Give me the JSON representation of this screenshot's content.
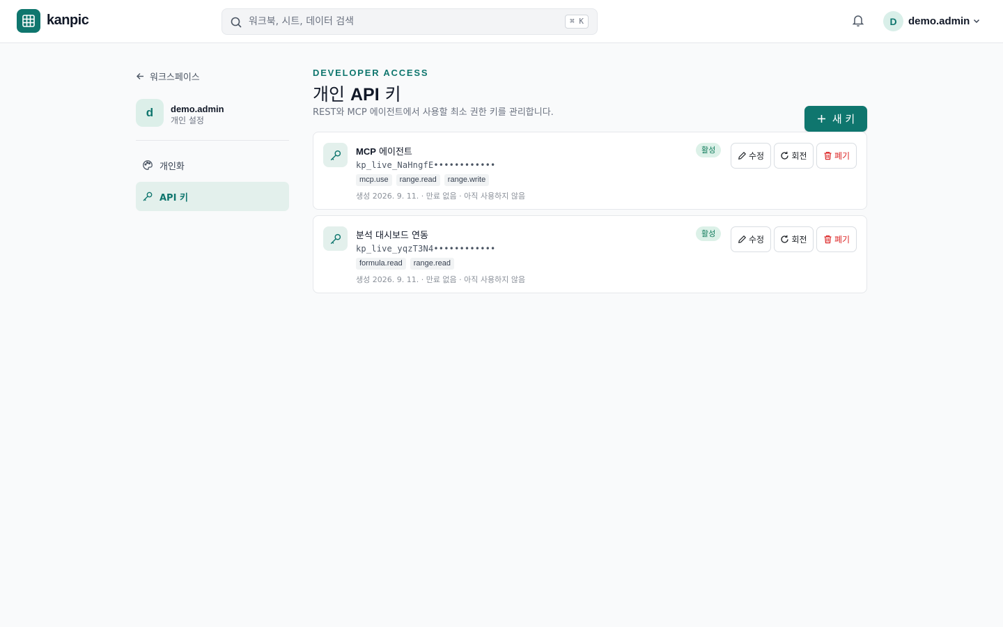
{
  "app": {
    "name": "kanpic"
  },
  "search": {
    "placeholder": "워크북, 시트, 데이터 검색",
    "shortcut": "⌘ K"
  },
  "user": {
    "initial": "D",
    "name": "demo.admin"
  },
  "sidebar": {
    "back_label": "워크스페이스",
    "profile": {
      "initial": "d",
      "name": "demo.admin",
      "subtitle": "개인 설정"
    },
    "items": [
      {
        "label": "개인화",
        "icon": "palette-icon",
        "active": false
      },
      {
        "label": "API 키",
        "icon": "key-icon",
        "active": true
      }
    ]
  },
  "main": {
    "eyebrow": "DEVELOPER ACCESS",
    "title_prefix": "개인",
    "title_bold": "API",
    "title_suffix": "키",
    "description": "REST와 MCP 에이전트에서 사용할 최소 권한 키를 관리합니다.",
    "new_key_label": "새 키",
    "actions": {
      "edit": "수정",
      "rotate": "회전",
      "revoke": "폐기"
    }
  },
  "keys": [
    {
      "name_en": "MCP",
      "name_rest": " 에이전트",
      "token": "kp_live_NaHngfE••••••••••••",
      "scopes": [
        "mcp.use",
        "range.read",
        "range.write"
      ],
      "meta": "생성 2026. 9. 11. · 만료 없음 · 아직 사용하지 않음",
      "status": "활성"
    },
    {
      "name_en": "",
      "name_rest": "분석 대시보드 연동",
      "token": "kp_live_yqzT3N4••••••••••••",
      "scopes": [
        "formula.read",
        "range.read"
      ],
      "meta": "생성 2026. 9. 11. · 만료 없음 · 아직 사용하지 않음",
      "status": "활성"
    }
  ],
  "colors": {
    "accent": "#0f766e",
    "accent_soft": "#e3f0ec",
    "danger": "#dc2626",
    "status_bg": "#dcf1e8"
  }
}
